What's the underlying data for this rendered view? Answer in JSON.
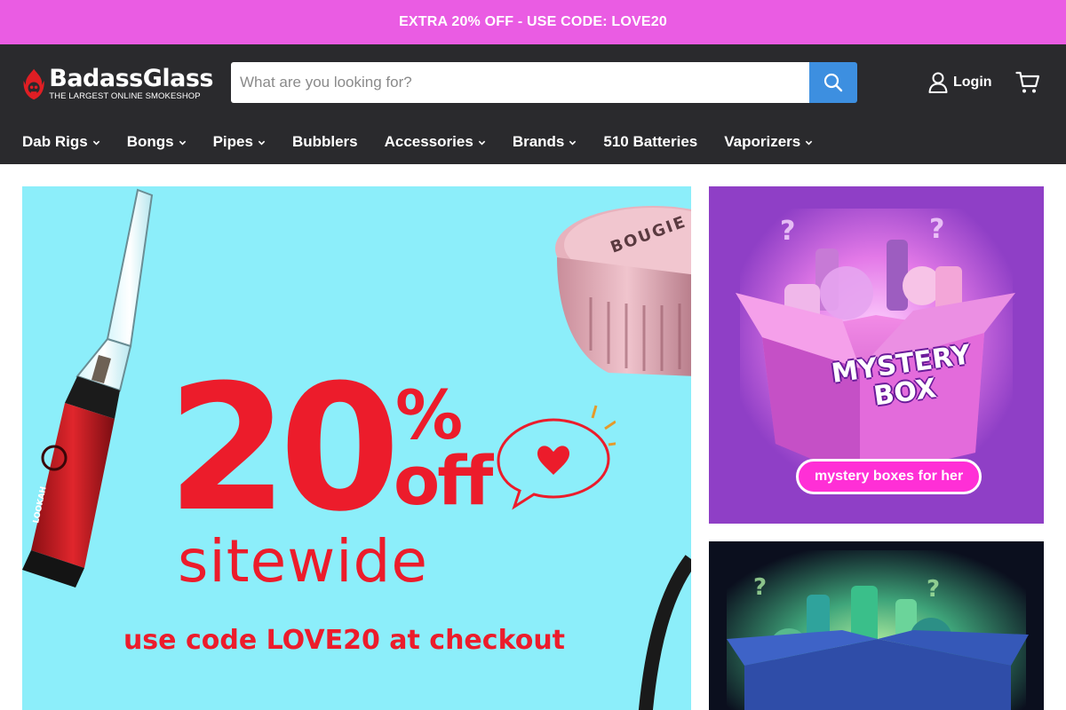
{
  "promo": {
    "text": "EXTRA 20% OFF - USE CODE: LOVE20"
  },
  "header": {
    "logo": {
      "name": "BadassGlass",
      "tagline": "THE LARGEST ONLINE SMOKESHOP"
    },
    "search": {
      "placeholder": "What are you looking for?",
      "value": "",
      "button_icon": "search-icon"
    },
    "login_label": "Login",
    "cart_icon": "cart-icon"
  },
  "nav": {
    "items": [
      {
        "label": "Dab Rigs",
        "has_dropdown": true
      },
      {
        "label": "Bongs",
        "has_dropdown": true
      },
      {
        "label": "Pipes",
        "has_dropdown": true
      },
      {
        "label": "Bubblers",
        "has_dropdown": false
      },
      {
        "label": "Accessories",
        "has_dropdown": true
      },
      {
        "label": "Brands",
        "has_dropdown": true
      },
      {
        "label": "510 Batteries",
        "has_dropdown": false
      },
      {
        "label": "Vaporizers",
        "has_dropdown": true
      }
    ]
  },
  "hero": {
    "big_number": "20",
    "percent": "%",
    "off": "off",
    "sitewide": "sitewide",
    "code_line": "use code LOVE20 at checkout",
    "grinder_brand": "BOUGIE",
    "device_brand": "LOOKAH"
  },
  "side_banners": [
    {
      "title_line1": "MYSTERY",
      "title_line2": "BOX",
      "pill": "mystery boxes for her"
    },
    {
      "title_line1": "",
      "title_line2": "",
      "pill": ""
    }
  ],
  "colors": {
    "promo_bg": "#ea5ce3",
    "header_bg": "#2a2a2d",
    "search_button": "#3d8fe0",
    "hero_bg": "#8ceefa",
    "hero_red": "#ec1c2b",
    "mystery_bg": "#8f3fc6",
    "mystery_pill": "#ff2fd6"
  }
}
